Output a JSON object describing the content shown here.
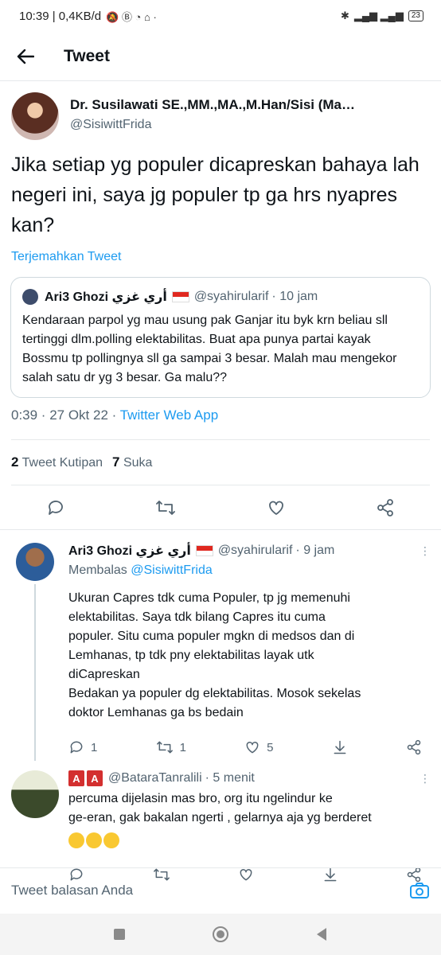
{
  "status_bar": {
    "left_text": "10:39 | 0,4KB/d",
    "battery": "23"
  },
  "header": {
    "title": "Tweet"
  },
  "tweet": {
    "author_name": "Dr. Susilawati SE.,MM.,MA.,M.Han/Sisi (Ma…",
    "handle": "@SisiwittFrida",
    "text": "Jika setiap yg populer dicapreskan bahaya lah negeri ini, saya jg populer tp ga hrs nyapres kan?",
    "translate_label": "Terjemahkan Tweet",
    "quote": {
      "name": "Ari3 Ghozi أري غزي",
      "handle": "@syahirularif",
      "time": "· 10 jam",
      "text": "Kendaraan parpol yg mau usung pak Ganjar itu byk krn beliau sll tertinggi dlm.polling elektabilitas. Buat apa punya partai kayak Bossmu tp pollingnya sll ga sampai 3 besar. Malah mau mengekor salah satu dr yg 3 besar. Ga malu??"
    },
    "timestamp": "0:39 · 27 Okt 22 · ",
    "source": "Twitter Web App",
    "stats": {
      "quotes_count": "2",
      "quotes_label": "Tweet Kutipan",
      "likes_count": "7",
      "likes_label": "Suka"
    }
  },
  "replies": [
    {
      "name": "Ari3 Ghozi أري غزي",
      "handle": "@syahirularif",
      "time": "· 9 jam",
      "replying_prefix": "Membalas",
      "replying_to": "@SisiwittFrida",
      "text_lines": [
        "Ukuran Capres tdk cuma Populer, tp jg memenuhi",
        "elektabilitas. Saya tdk bilang Capres itu cuma",
        "populer. Situ cuma populer mgkn di medsos dan di",
        "Lemhanas, tp tdk pny elektabilitas layak utk",
        "diCapreskan",
        "Bedakan ya populer dg elektabilitas. Mosok sekelas",
        "doktor Lemhanas ga bs bedain"
      ],
      "reply_count": "1",
      "retweet_count": "1",
      "like_count": "5"
    },
    {
      "badge_letters": [
        "A",
        "A"
      ],
      "handle": "@BataraTanralili",
      "time": "· 5 menit",
      "text_lines": [
        "percuma dijelasin mas bro, org itu ngelindur ke",
        "ge-eran, gak bakalan ngerti , gelarnya aja yg berderet"
      ],
      "emojis": [
        "face-with-tears-of-joy",
        "face-with-tears-of-joy",
        "face-with-tears-of-joy"
      ]
    }
  ],
  "composer": {
    "placeholder": "Tweet balasan Anda"
  },
  "colors": {
    "accent": "#1d9bf0",
    "text": "#0f1419",
    "secondary": "#536471",
    "divider": "#e6e9eb"
  }
}
